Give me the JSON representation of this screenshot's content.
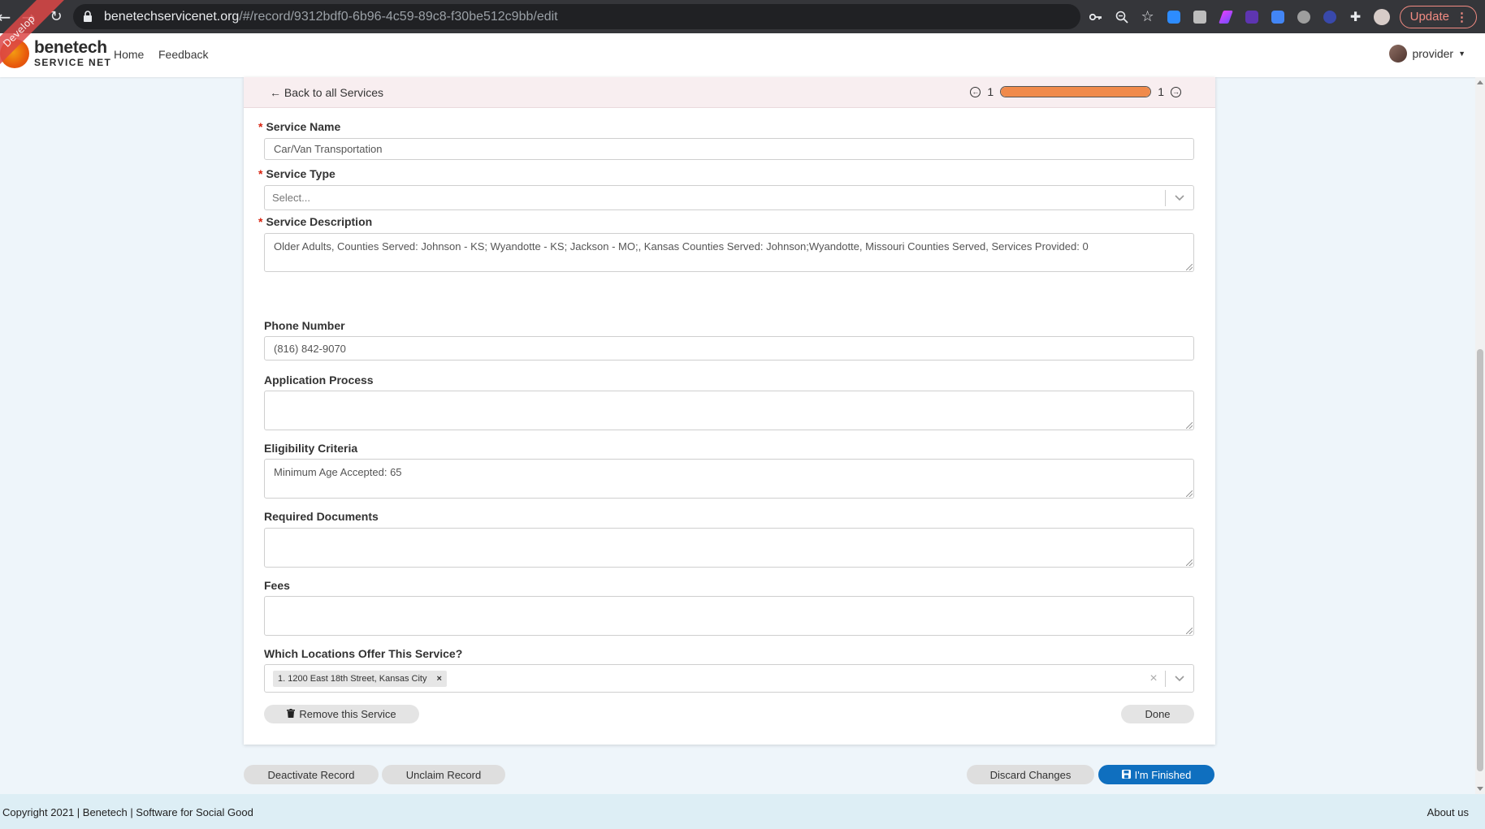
{
  "browser": {
    "url_host": "benetechservicenet.org",
    "url_path": "/#/record/9312bdf0-6b96-4c59-89c8-f30be512c9bb/edit",
    "update_label": "Update"
  },
  "nav": {
    "logo_line1": "benetech",
    "logo_line2": "SERVICE NET",
    "ribbon": "Develop",
    "home": "Home",
    "feedback": "Feedback",
    "user": "provider"
  },
  "card": {
    "back_link": "Back to all Services",
    "pager_current": "1",
    "pager_total": "1",
    "progress_fraction": 1.0
  },
  "form": {
    "service_name": {
      "label": "Service Name",
      "value": "Car/Van Transportation"
    },
    "service_type": {
      "label": "Service Type",
      "placeholder": "Select..."
    },
    "service_description": {
      "label": "Service Description",
      "value": "Older Adults, Counties Served: Johnson - KS; Wyandotte - KS; Jackson - MO;, Kansas Counties Served: Johnson;Wyandotte, Missouri Counties Served, Services Provided: 0"
    },
    "phone_number": {
      "label": "Phone Number",
      "value": "(816) 842-9070"
    },
    "application_process": {
      "label": "Application Process",
      "value": ""
    },
    "eligibility_criteria": {
      "label": "Eligibility Criteria",
      "value": "Minimum Age Accepted: 65"
    },
    "required_documents": {
      "label": "Required Documents",
      "value": ""
    },
    "fees": {
      "label": "Fees",
      "value": ""
    },
    "locations": {
      "label": "Which Locations Offer This Service?",
      "tags": [
        "1. 1200 East 18th Street, Kansas City"
      ]
    }
  },
  "card_actions": {
    "remove": "Remove this Service",
    "done": "Done"
  },
  "page_actions": {
    "deactivate": "Deactivate Record",
    "unclaim": "Unclaim Record",
    "discard": "Discard Changes",
    "finished": "I'm Finished"
  },
  "footer": {
    "copyright": "Copyright 2021 | Benetech | Software for Social Good",
    "about": "About us"
  },
  "colors": {
    "accent": "#0f6fbf",
    "progress": "#f08a4b",
    "required": "#d9230f",
    "card_header": "#f8eef0"
  }
}
